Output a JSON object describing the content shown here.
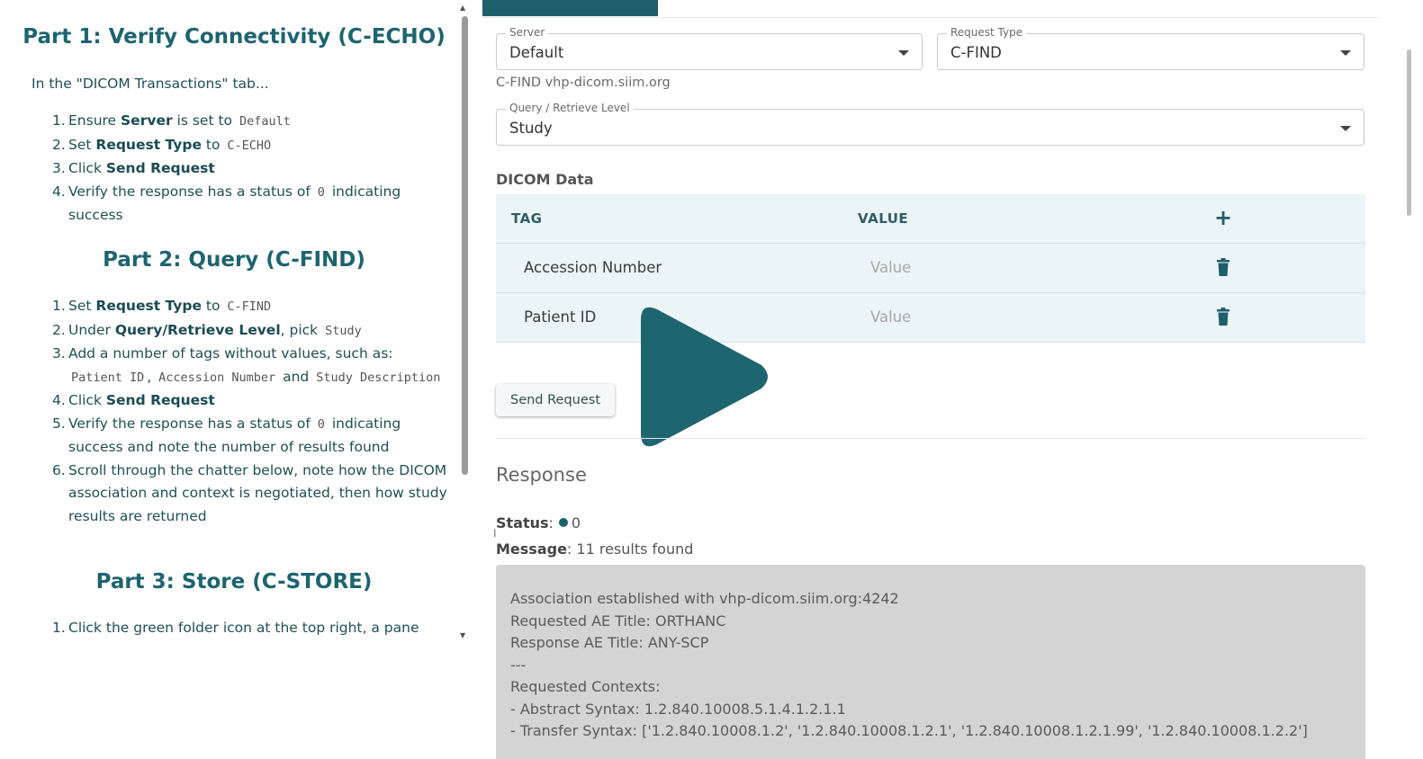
{
  "instructions": {
    "part1": {
      "title": "Part 1: Verify Connectivity (C-ECHO)",
      "intro": "In the \"DICOM Transactions\" tab...",
      "steps": [
        {
          "num": "1.",
          "text1": "Ensure ",
          "bold": "Server",
          "text2": " is set to ",
          "code": "Default"
        },
        {
          "num": "2.",
          "text1": "Set ",
          "bold": "Request Type",
          "text2": " to ",
          "code": "C-ECHO"
        },
        {
          "num": "3.",
          "text1": "Click ",
          "bold": "Send Request"
        },
        {
          "num": "4.",
          "text1": "Verify the response has a status of ",
          "code": "0",
          "text2": " indicating success"
        }
      ]
    },
    "part2": {
      "title": "Part 2: Query (C-FIND)",
      "steps": [
        {
          "num": "1.",
          "text1": "Set ",
          "bold": "Request Type",
          "text2": " to ",
          "code": "C-FIND"
        },
        {
          "num": "2.",
          "text1": "Under ",
          "bold": "Query/Retrieve Level",
          "text2": ", pick ",
          "code": "Study"
        },
        {
          "num": "3.",
          "text1": "Add a number of tags without values, such as: ",
          "code1": "Patient ID",
          "sep1": ", ",
          "code2": "Accession Number",
          "sep2": " and ",
          "code3": "Study Description"
        },
        {
          "num": "4.",
          "text1": "Click ",
          "bold": "Send Request"
        },
        {
          "num": "5.",
          "text1": "Verify the response has a status of ",
          "code": "0",
          "text2": " indicating success and note the number of results found"
        },
        {
          "num": "6.",
          "text1": "Scroll through the chatter below, note how the DICOM association and context is negotiated, then how study results are returned"
        }
      ]
    },
    "part3": {
      "title": "Part 3: Store (C-STORE)",
      "steps": [
        {
          "num": "1.",
          "text1": "Click the green folder icon at the top right, a pane"
        }
      ]
    }
  },
  "form": {
    "server": {
      "label": "Server",
      "value": "Default"
    },
    "request_type": {
      "label": "Request Type",
      "value": "C-FIND"
    },
    "helper": "C-FIND vhp-dicom.siim.org",
    "level": {
      "label": "Query / Retrieve Level",
      "value": "Study"
    }
  },
  "dicom": {
    "title": "DICOM Data",
    "headers": {
      "tag": "TAG",
      "value": "VALUE",
      "add": "+"
    },
    "rows": [
      {
        "tag": "Accession Number",
        "placeholder": "Value"
      },
      {
        "tag": "Patient ID",
        "placeholder": "Value"
      }
    ]
  },
  "send_label": "Send Request",
  "response": {
    "title": "Response",
    "status_label": "Status",
    "status_value": "0",
    "message_label": "Message",
    "message_value": "11 results found",
    "log": [
      "Association established with vhp-dicom.siim.org:4242",
      "Requested AE Title: ORTHANC",
      "Response AE Title: ANY-SCP",
      "---",
      "Requested Contexts:",
      "- Abstract Syntax: 1.2.840.10008.5.1.4.1.2.1.1",
      "- Transfer Syntax: ['1.2.840.10008.1.2', '1.2.840.10008.1.2.1', '1.2.840.10008.1.2.1.99', '1.2.840.10008.1.2.2']"
    ]
  },
  "colors": {
    "accent": "#1d5f6a",
    "heading": "#1d6470",
    "table_bg": "#ebf4f7",
    "log_bg": "#d4d4d4"
  },
  "icons": {
    "add": "plus-icon",
    "delete": "trash-icon",
    "dropdown": "caret-down-icon",
    "video": "play-icon"
  }
}
